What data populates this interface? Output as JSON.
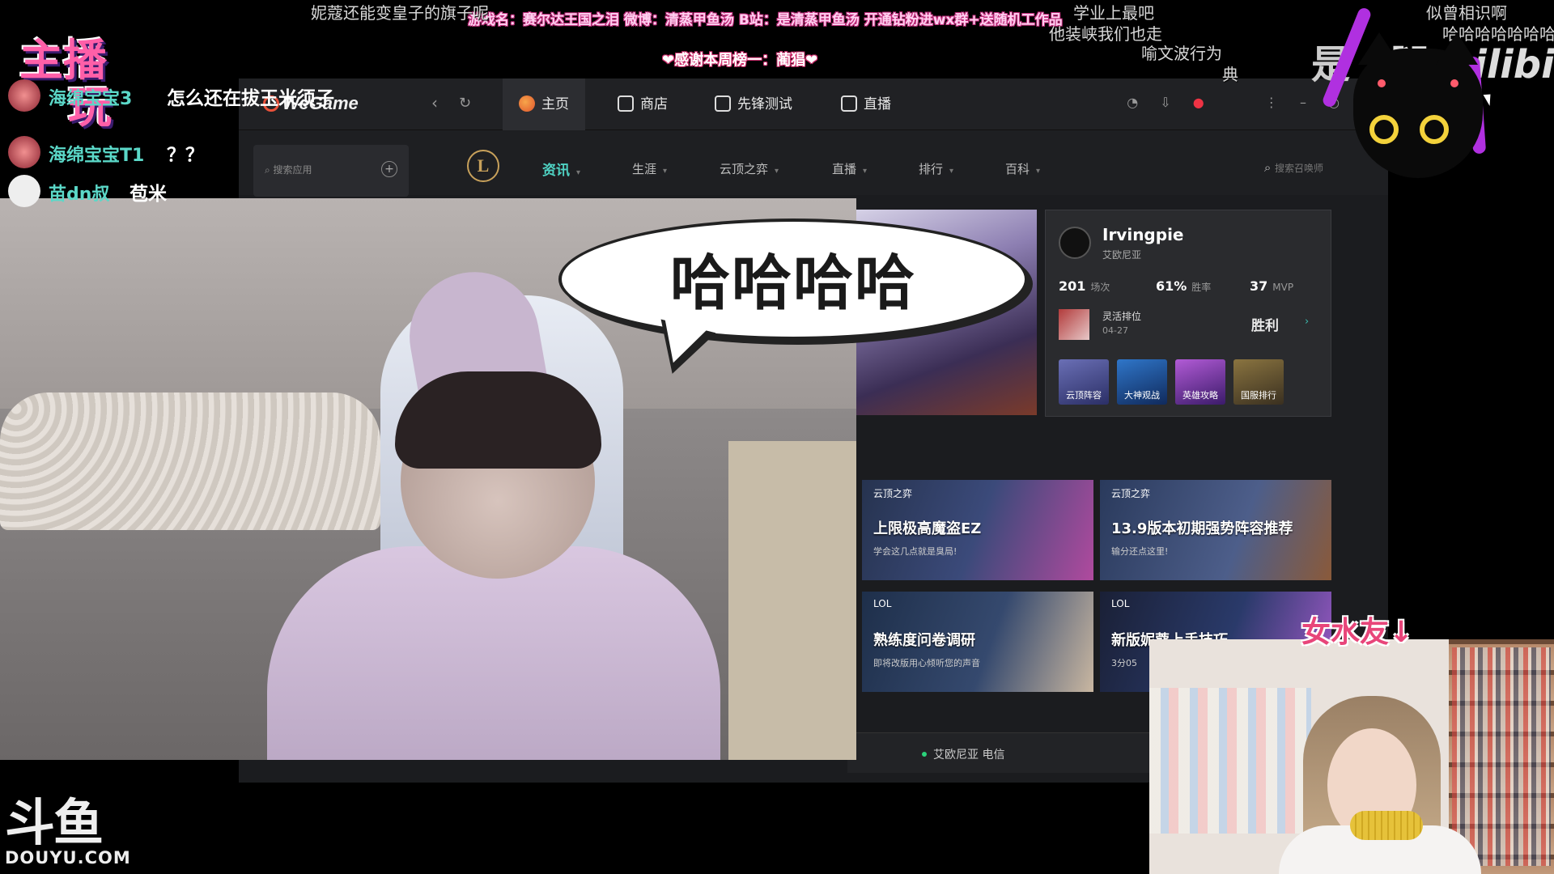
{
  "wegame": {
    "logo": "WeGame",
    "top_tabs": [
      "主页",
      "商店",
      "先锋测试",
      "直播"
    ],
    "search_app_placeholder": "搜索应用",
    "lol_logo": "L",
    "lol_tabs": [
      "资讯",
      "生涯",
      "云顶之弈",
      "直播",
      "排行",
      "百科"
    ],
    "summoner_search_placeholder": "搜索召唤师",
    "profile": {
      "name": "Irvingpie",
      "server": "艾欧尼亚",
      "games": "201",
      "games_label": "场次",
      "winrate": "61%",
      "winrate_label": "胜率",
      "mvp": "37",
      "mvp_label": "MVP",
      "last_match_mode": "灵活排位",
      "last_match_date": "04-27",
      "last_match_result": "胜利",
      "shortcuts": [
        "云顶阵容",
        "大神观战",
        "英雄攻略",
        "国服排行"
      ]
    },
    "news": [
      {
        "tag": "云顶之弈",
        "title": "上限极高魔盗EZ",
        "desc": "学会这几点就是臭局!"
      },
      {
        "tag": "云顶之弈",
        "title": "13.9版本初期强势阵容推荐",
        "desc": "输分还点这里!"
      },
      {
        "tag": "LOL",
        "title": "熟练度问卷调研",
        "desc": "即将改版用心倾听您的声音"
      },
      {
        "tag": "LOL",
        "title": "新版妮蔻上手技巧",
        "desc": "3分05"
      }
    ],
    "server_status": "艾欧尼亚 电信"
  },
  "overlay": {
    "bubble_text": "哈哈哈哈",
    "ticker": "游戏名：赛尔达王国之泪 微博：清蒸甲鱼汤 B站：是清蒸甲鱼汤 开通钻粉进wx群+送随机工作品",
    "thanks": "❤感谢本周榜一：蔺猖❤",
    "anchor_badge_line1": "主播",
    "anchor_badge_line2": "玩",
    "chat": [
      {
        "user": "海绵宝宝3",
        "msg": "怎么还在拔玉米须子"
      },
      {
        "user": "海绵宝宝T1",
        "msg": "？？"
      },
      {
        "user": "苗dn叔",
        "msg": "苞米"
      }
    ],
    "danmaku": [
      "妮蔻还能变皇子的旗子呢",
      "学业上最吧",
      "他装峡我们也走",
      "喻文波行为",
      "典",
      "似曾相识啊",
      "哈哈哈哈哈哈哈"
    ],
    "douyu_cn": "斗鱼",
    "douyu_en": "DOUYU.COM",
    "bili_shi": "是",
    "bili_tui": "腿",
    "bili_logo": "bilibili",
    "girlfriend_label": "女水友↓"
  }
}
